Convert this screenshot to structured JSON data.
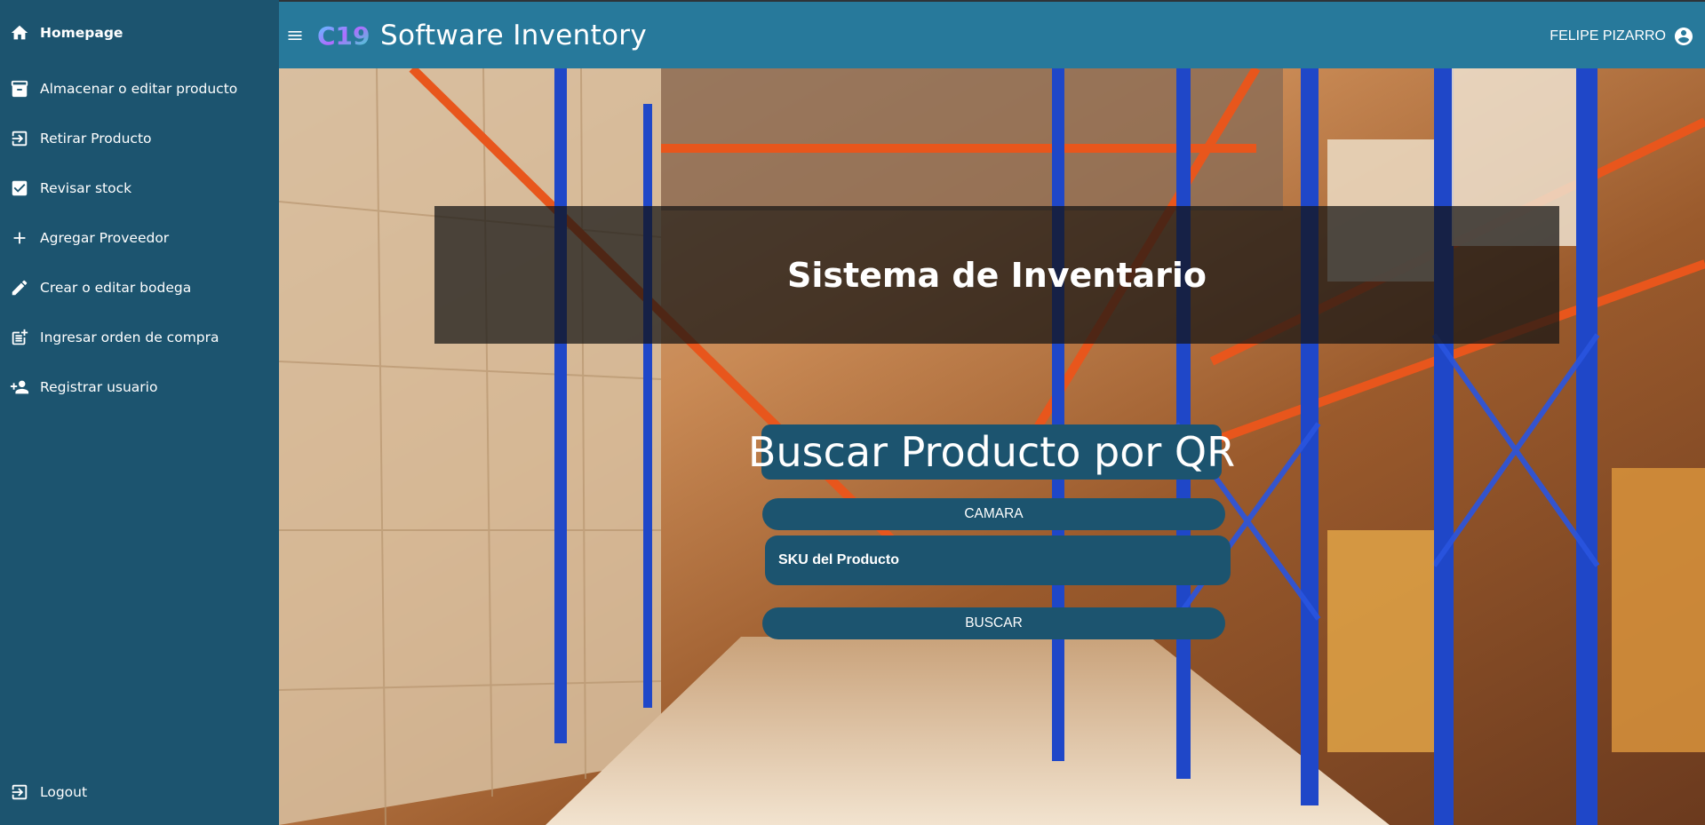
{
  "sidebar": {
    "items": [
      {
        "label": "Homepage",
        "icon": "home-icon"
      },
      {
        "label": "Almacenar o editar producto",
        "icon": "archive-icon"
      },
      {
        "label": "Retirar Producto",
        "icon": "exit-to-app-icon"
      },
      {
        "label": "Revisar stock",
        "icon": "checkbox-icon"
      },
      {
        "label": "Agregar Proveedor",
        "icon": "plus-icon"
      },
      {
        "label": "Crear o editar bodega",
        "icon": "pencil-icon"
      },
      {
        "label": "Ingresar orden de compra",
        "icon": "post-add-icon"
      },
      {
        "label": "Registrar usuario",
        "icon": "person-add-icon"
      }
    ],
    "logout": {
      "label": "Logout",
      "icon": "logout-icon"
    }
  },
  "header": {
    "logo_text": "C19",
    "title": "Software Inventory",
    "user_name": "FELIPE PIZARRO"
  },
  "main": {
    "banner_title": "Sistema de Inventario",
    "search_title": "Buscar Producto por QR",
    "camera_button": "CAMARA",
    "sku_placeholder": "SKU del Producto",
    "search_button": "BUSCAR"
  },
  "colors": {
    "sidebar": "#1c546f",
    "header": "#27799b",
    "panel": "#1c546f"
  }
}
